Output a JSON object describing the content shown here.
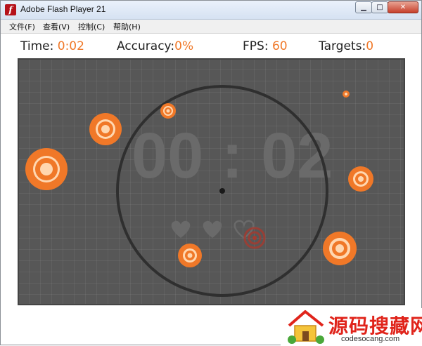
{
  "window": {
    "title": "Adobe Flash Player 21"
  },
  "menu": [
    "文件(F)",
    "查看(V)",
    "控制(C)",
    "帮助(H)"
  ],
  "hud": {
    "time_label": "Time",
    "time_value": "0:02",
    "accuracy_label": "Accuracy",
    "accuracy_value": "0%",
    "fps_label": "FPS",
    "fps_value": "60",
    "targets_label": "Targets",
    "targets_value": "0"
  },
  "game": {
    "big_timer": "00 : 02",
    "lives_total": 3,
    "lives_remaining": 2,
    "colors": {
      "target": "#f07828",
      "target_light": "#ffd7b0",
      "arena": "#575757",
      "ring": "#2f2f2f",
      "life": "#6a6a6a",
      "miss": "#a83a2e"
    }
  },
  "watermark": {
    "text": "源码搜藏网",
    "sub": "codesocang.com"
  }
}
